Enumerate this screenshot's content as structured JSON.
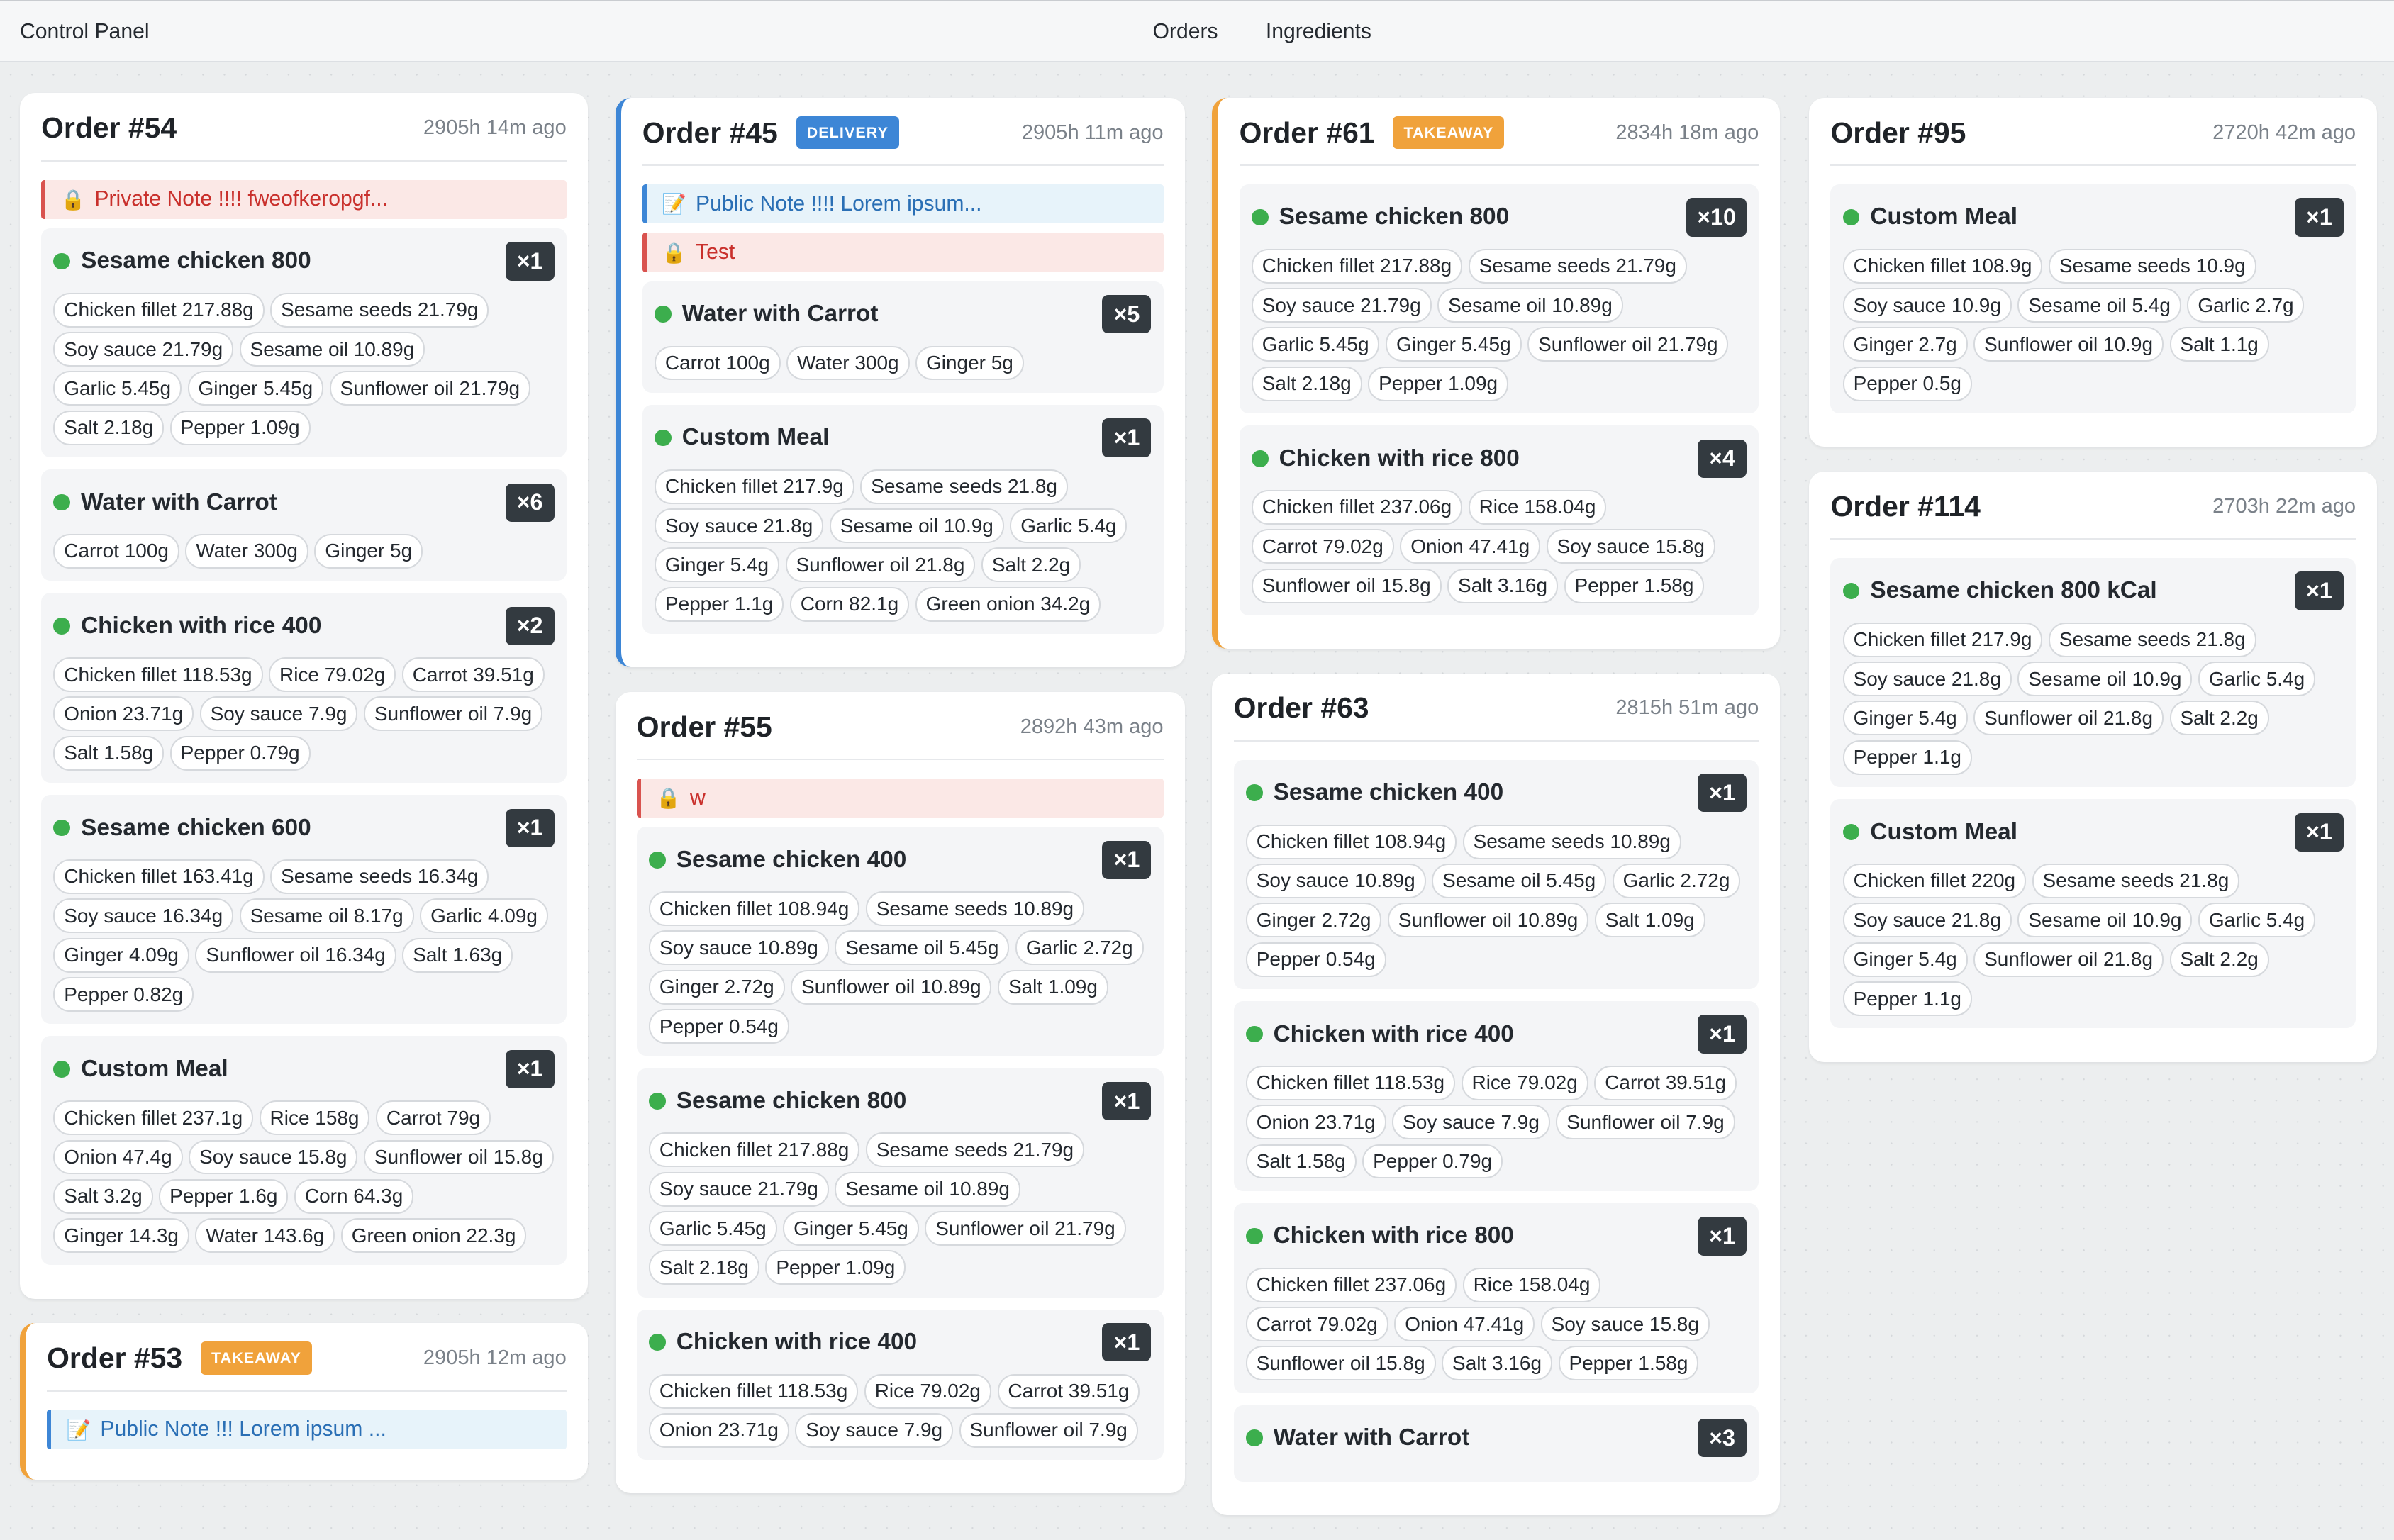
{
  "app": {
    "title": "Control Panel"
  },
  "nav": {
    "orders": "Orders",
    "ingredients": "Ingredients"
  },
  "columns": [
    [
      {
        "title": "Order #54",
        "time": "2905h 14m ago",
        "badge": "",
        "type": "",
        "notes": [
          {
            "kind": "private",
            "text": "Private Note !!!! fweofkeropgf..."
          }
        ],
        "items": [
          {
            "name": "Sesame chicken 800",
            "qty": "×1",
            "ingredients": [
              "Chicken fillet 217.88g",
              "Sesame seeds 21.79g",
              "Soy sauce 21.79g",
              "Sesame oil 10.89g",
              "Garlic 5.45g",
              "Ginger 5.45g",
              "Sunflower oil 21.79g",
              "Salt 2.18g",
              "Pepper 1.09g"
            ]
          },
          {
            "name": "Water with Carrot",
            "qty": "×6",
            "ingredients": [
              "Carrot 100g",
              "Water 300g",
              "Ginger 5g"
            ]
          },
          {
            "name": "Chicken with rice 400",
            "qty": "×2",
            "ingredients": [
              "Chicken fillet 118.53g",
              "Rice 79.02g",
              "Carrot 39.51g",
              "Onion 23.71g",
              "Soy sauce 7.9g",
              "Sunflower oil 7.9g",
              "Salt 1.58g",
              "Pepper 0.79g"
            ]
          },
          {
            "name": "Sesame chicken 600",
            "qty": "×1",
            "ingredients": [
              "Chicken fillet 163.41g",
              "Sesame seeds 16.34g",
              "Soy sauce 16.34g",
              "Sesame oil 8.17g",
              "Garlic 4.09g",
              "Ginger 4.09g",
              "Sunflower oil 16.34g",
              "Salt 1.63g",
              "Pepper 0.82g"
            ]
          },
          {
            "name": "Custom Meal",
            "qty": "×1",
            "ingredients": [
              "Chicken fillet 237.1g",
              "Rice 158g",
              "Carrot 79g",
              "Onion 47.4g",
              "Soy sauce 15.8g",
              "Sunflower oil 15.8g",
              "Salt 3.2g",
              "Pepper 1.6g",
              "Corn 64.3g",
              "Ginger 14.3g",
              "Water 143.6g",
              "Green onion 22.3g"
            ]
          }
        ]
      },
      {
        "title": "Order #53",
        "time": "2905h 12m ago",
        "badge": "TAKEAWAY",
        "type": "takeaway",
        "notes": [
          {
            "kind": "public",
            "text": "Public Note !!! Lorem ipsum ..."
          }
        ],
        "items": []
      }
    ],
    [
      {
        "title": "Order #45",
        "time": "2905h 11m ago",
        "badge": "DELIVERY",
        "type": "delivery",
        "notes": [
          {
            "kind": "public",
            "text": "Public Note !!!! Lorem ipsum..."
          },
          {
            "kind": "private",
            "text": "Test"
          }
        ],
        "items": [
          {
            "name": "Water with Carrot",
            "qty": "×5",
            "ingredients": [
              "Carrot 100g",
              "Water 300g",
              "Ginger 5g"
            ]
          },
          {
            "name": "Custom Meal",
            "qty": "×1",
            "ingredients": [
              "Chicken fillet 217.9g",
              "Sesame seeds 21.8g",
              "Soy sauce 21.8g",
              "Sesame oil 10.9g",
              "Garlic 5.4g",
              "Ginger 5.4g",
              "Sunflower oil 21.8g",
              "Salt 2.2g",
              "Pepper 1.1g",
              "Corn 82.1g",
              "Green onion 34.2g"
            ]
          }
        ]
      },
      {
        "title": "Order #55",
        "time": "2892h 43m ago",
        "badge": "",
        "type": "",
        "notes": [
          {
            "kind": "private",
            "text": "w"
          }
        ],
        "items": [
          {
            "name": "Sesame chicken 400",
            "qty": "×1",
            "ingredients": [
              "Chicken fillet 108.94g",
              "Sesame seeds 10.89g",
              "Soy sauce 10.89g",
              "Sesame oil 5.45g",
              "Garlic 2.72g",
              "Ginger 2.72g",
              "Sunflower oil 10.89g",
              "Salt 1.09g",
              "Pepper 0.54g"
            ]
          },
          {
            "name": "Sesame chicken 800",
            "qty": "×1",
            "ingredients": [
              "Chicken fillet 217.88g",
              "Sesame seeds 21.79g",
              "Soy sauce 21.79g",
              "Sesame oil 10.89g",
              "Garlic 5.45g",
              "Ginger 5.45g",
              "Sunflower oil 21.79g",
              "Salt 2.18g",
              "Pepper 1.09g"
            ]
          },
          {
            "name": "Chicken with rice 400",
            "qty": "×1",
            "ingredients": [
              "Chicken fillet 118.53g",
              "Rice 79.02g",
              "Carrot 39.51g",
              "Onion 23.71g",
              "Soy sauce 7.9g",
              "Sunflower oil 7.9g"
            ]
          }
        ]
      }
    ],
    [
      {
        "title": "Order #61",
        "time": "2834h 18m ago",
        "badge": "TAKEAWAY",
        "type": "takeaway",
        "notes": [],
        "items": [
          {
            "name": "Sesame chicken 800",
            "qty": "×10",
            "ingredients": [
              "Chicken fillet 217.88g",
              "Sesame seeds 21.79g",
              "Soy sauce 21.79g",
              "Sesame oil 10.89g",
              "Garlic 5.45g",
              "Ginger 5.45g",
              "Sunflower oil 21.79g",
              "Salt 2.18g",
              "Pepper 1.09g"
            ]
          },
          {
            "name": "Chicken with rice 800",
            "qty": "×4",
            "ingredients": [
              "Chicken fillet 237.06g",
              "Rice 158.04g",
              "Carrot 79.02g",
              "Onion 47.41g",
              "Soy sauce 15.8g",
              "Sunflower oil 15.8g",
              "Salt 3.16g",
              "Pepper 1.58g"
            ]
          }
        ]
      },
      {
        "title": "Order #63",
        "time": "2815h 51m ago",
        "badge": "",
        "type": "",
        "notes": [],
        "items": [
          {
            "name": "Sesame chicken 400",
            "qty": "×1",
            "ingredients": [
              "Chicken fillet 108.94g",
              "Sesame seeds 10.89g",
              "Soy sauce 10.89g",
              "Sesame oil 5.45g",
              "Garlic 2.72g",
              "Ginger 2.72g",
              "Sunflower oil 10.89g",
              "Salt 1.09g",
              "Pepper 0.54g"
            ]
          },
          {
            "name": "Chicken with rice 400",
            "qty": "×1",
            "ingredients": [
              "Chicken fillet 118.53g",
              "Rice 79.02g",
              "Carrot 39.51g",
              "Onion 23.71g",
              "Soy sauce 7.9g",
              "Sunflower oil 7.9g",
              "Salt 1.58g",
              "Pepper 0.79g"
            ]
          },
          {
            "name": "Chicken with rice 800",
            "qty": "×1",
            "ingredients": [
              "Chicken fillet 237.06g",
              "Rice 158.04g",
              "Carrot 79.02g",
              "Onion 47.41g",
              "Soy sauce 15.8g",
              "Sunflower oil 15.8g",
              "Salt 3.16g",
              "Pepper 1.58g"
            ]
          },
          {
            "name": "Water with Carrot",
            "qty": "×3",
            "ingredients": []
          }
        ]
      }
    ],
    [
      {
        "title": "Order #95",
        "time": "2720h 42m ago",
        "badge": "",
        "type": "",
        "notes": [],
        "items": [
          {
            "name": "Custom Meal",
            "qty": "×1",
            "ingredients": [
              "Chicken fillet 108.9g",
              "Sesame seeds 10.9g",
              "Soy sauce 10.9g",
              "Sesame oil 5.4g",
              "Garlic 2.7g",
              "Ginger 2.7g",
              "Sunflower oil 10.9g",
              "Salt 1.1g",
              "Pepper 0.5g"
            ]
          }
        ]
      },
      {
        "title": "Order #114",
        "time": "2703h 22m ago",
        "badge": "",
        "type": "",
        "notes": [],
        "items": [
          {
            "name": "Sesame chicken 800 kCal",
            "qty": "×1",
            "ingredients": [
              "Chicken fillet 217.9g",
              "Sesame seeds 21.8g",
              "Soy sauce 21.8g",
              "Sesame oil 10.9g",
              "Garlic 5.4g",
              "Ginger 5.4g",
              "Sunflower oil 21.8g",
              "Salt 2.2g",
              "Pepper 1.1g"
            ]
          },
          {
            "name": "Custom Meal",
            "qty": "×1",
            "ingredients": [
              "Chicken fillet 220g",
              "Sesame seeds 21.8g",
              "Soy sauce 21.8g",
              "Sesame oil 10.9g",
              "Garlic 5.4g",
              "Ginger 5.4g",
              "Sunflower oil 21.8g",
              "Salt 2.2g",
              "Pepper 1.1g"
            ]
          }
        ]
      }
    ]
  ]
}
